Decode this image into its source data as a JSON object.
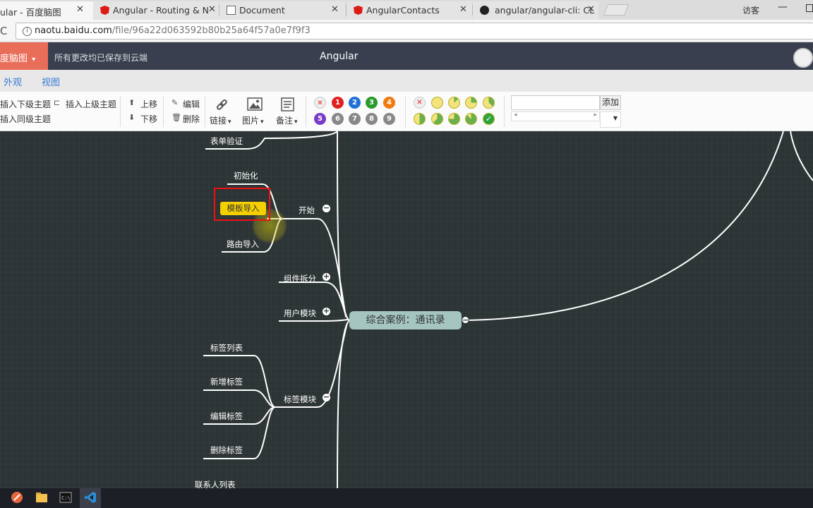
{
  "browser": {
    "tabs": [
      {
        "title": "ular - 百度脑图",
        "icon": "naotu-icon",
        "active": true
      },
      {
        "title": "Angular - Routing & N",
        "icon": "angular-icon",
        "active": false
      },
      {
        "title": "Document",
        "icon": "document-icon",
        "active": false
      },
      {
        "title": "AngularContacts",
        "icon": "angular-icon",
        "active": false
      },
      {
        "title": "angular/angular-cli: CL",
        "icon": "github-icon",
        "active": false
      }
    ],
    "close_glyph": "✕",
    "user_label": "访客",
    "minimize_glyph": "—",
    "reload_glyph": "C",
    "info_glyph": "i",
    "url_host": "naotu.baidu.com",
    "url_path": "/file/96a22d063592b80b25a64f57a0e7f9f3"
  },
  "app": {
    "brand": "度脑图",
    "brand_caret": "▾",
    "save_status": "所有更改均已保存到云端",
    "doc_title": "Angular",
    "menu_tabs": [
      "外观",
      "视图"
    ]
  },
  "toolbar": {
    "insert_child": "插入下级主题",
    "insert_parent": "插入上级主题",
    "insert_sibling": "插入同级主题",
    "move_up": "上移",
    "move_down": "下移",
    "edit": "编辑",
    "delete": "删除",
    "link": "链接",
    "image": "图片",
    "note": "备注",
    "dropdown_caret": "▾",
    "priority_badges": [
      "✕",
      "1",
      "2",
      "3",
      "4",
      "5",
      "6",
      "7",
      "8",
      "9"
    ],
    "add_button": "添加",
    "scroll_left": "◂",
    "scroll_right": "▸",
    "dropdown_arrow": "▼"
  },
  "mindmap": {
    "central": "综合案例：通讯录",
    "nodes": {
      "form_validation": "表单验证",
      "init": "初始化",
      "template_import": "模板导入",
      "router_import": "路由导入",
      "start": "开始",
      "component_split": "组件拆分",
      "user_module": "用户模块",
      "tag_list": "标签列表",
      "add_tag": "新增标签",
      "edit_tag": "编辑标签",
      "delete_tag": "删除标签",
      "tag_module": "标签模块",
      "contact_list": "联系人列表"
    },
    "expanded_glyph": "−",
    "collapsed_glyph": "+"
  },
  "colors": {
    "canvas_bg": "#2d3436",
    "header_bg": "#393f4f",
    "brand_bg": "#e96e5a",
    "central_bg": "#a4c5c0",
    "selected_bg": "#f5d000",
    "selection_border": "#e11111"
  }
}
